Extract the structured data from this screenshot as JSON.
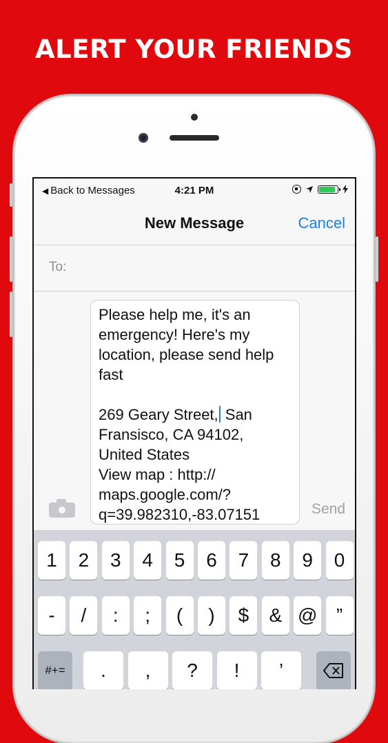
{
  "headline": "ALERT YOUR FRIENDS",
  "status_bar": {
    "back_label": "Back to Messages",
    "time": "4:21 PM",
    "icons": [
      "rotation-lock-icon",
      "location-arrow-icon",
      "battery-icon",
      "charging-bolt-icon"
    ],
    "battery_level": 0.9
  },
  "nav": {
    "title": "New Message",
    "cancel": "Cancel"
  },
  "to_field": {
    "label": "To:",
    "value": ""
  },
  "message": {
    "paragraph1": "Please help me, it's an emergency! Here's my location, please send help fast",
    "address_before_cursor": "269 Geary Street,",
    "address_after_cursor": " San Fransisco, CA 94102, United States",
    "map_line": "View map : http:// maps.google.com/? q=39.982310,-83.07151"
  },
  "send_label": "Send",
  "keyboard": {
    "row1": [
      "1",
      "2",
      "3",
      "4",
      "5",
      "6",
      "7",
      "8",
      "9",
      "0"
    ],
    "row2": [
      "-",
      "/",
      ":",
      ";",
      "(",
      ")",
      "$",
      "&",
      "@",
      "”"
    ],
    "row3_left": "#+=",
    "row3": [
      ".",
      ",",
      "?",
      "!",
      "’"
    ]
  },
  "colors": {
    "background": "#e00a0e",
    "accent": "#1b7fe6",
    "battery": "#34c759"
  }
}
